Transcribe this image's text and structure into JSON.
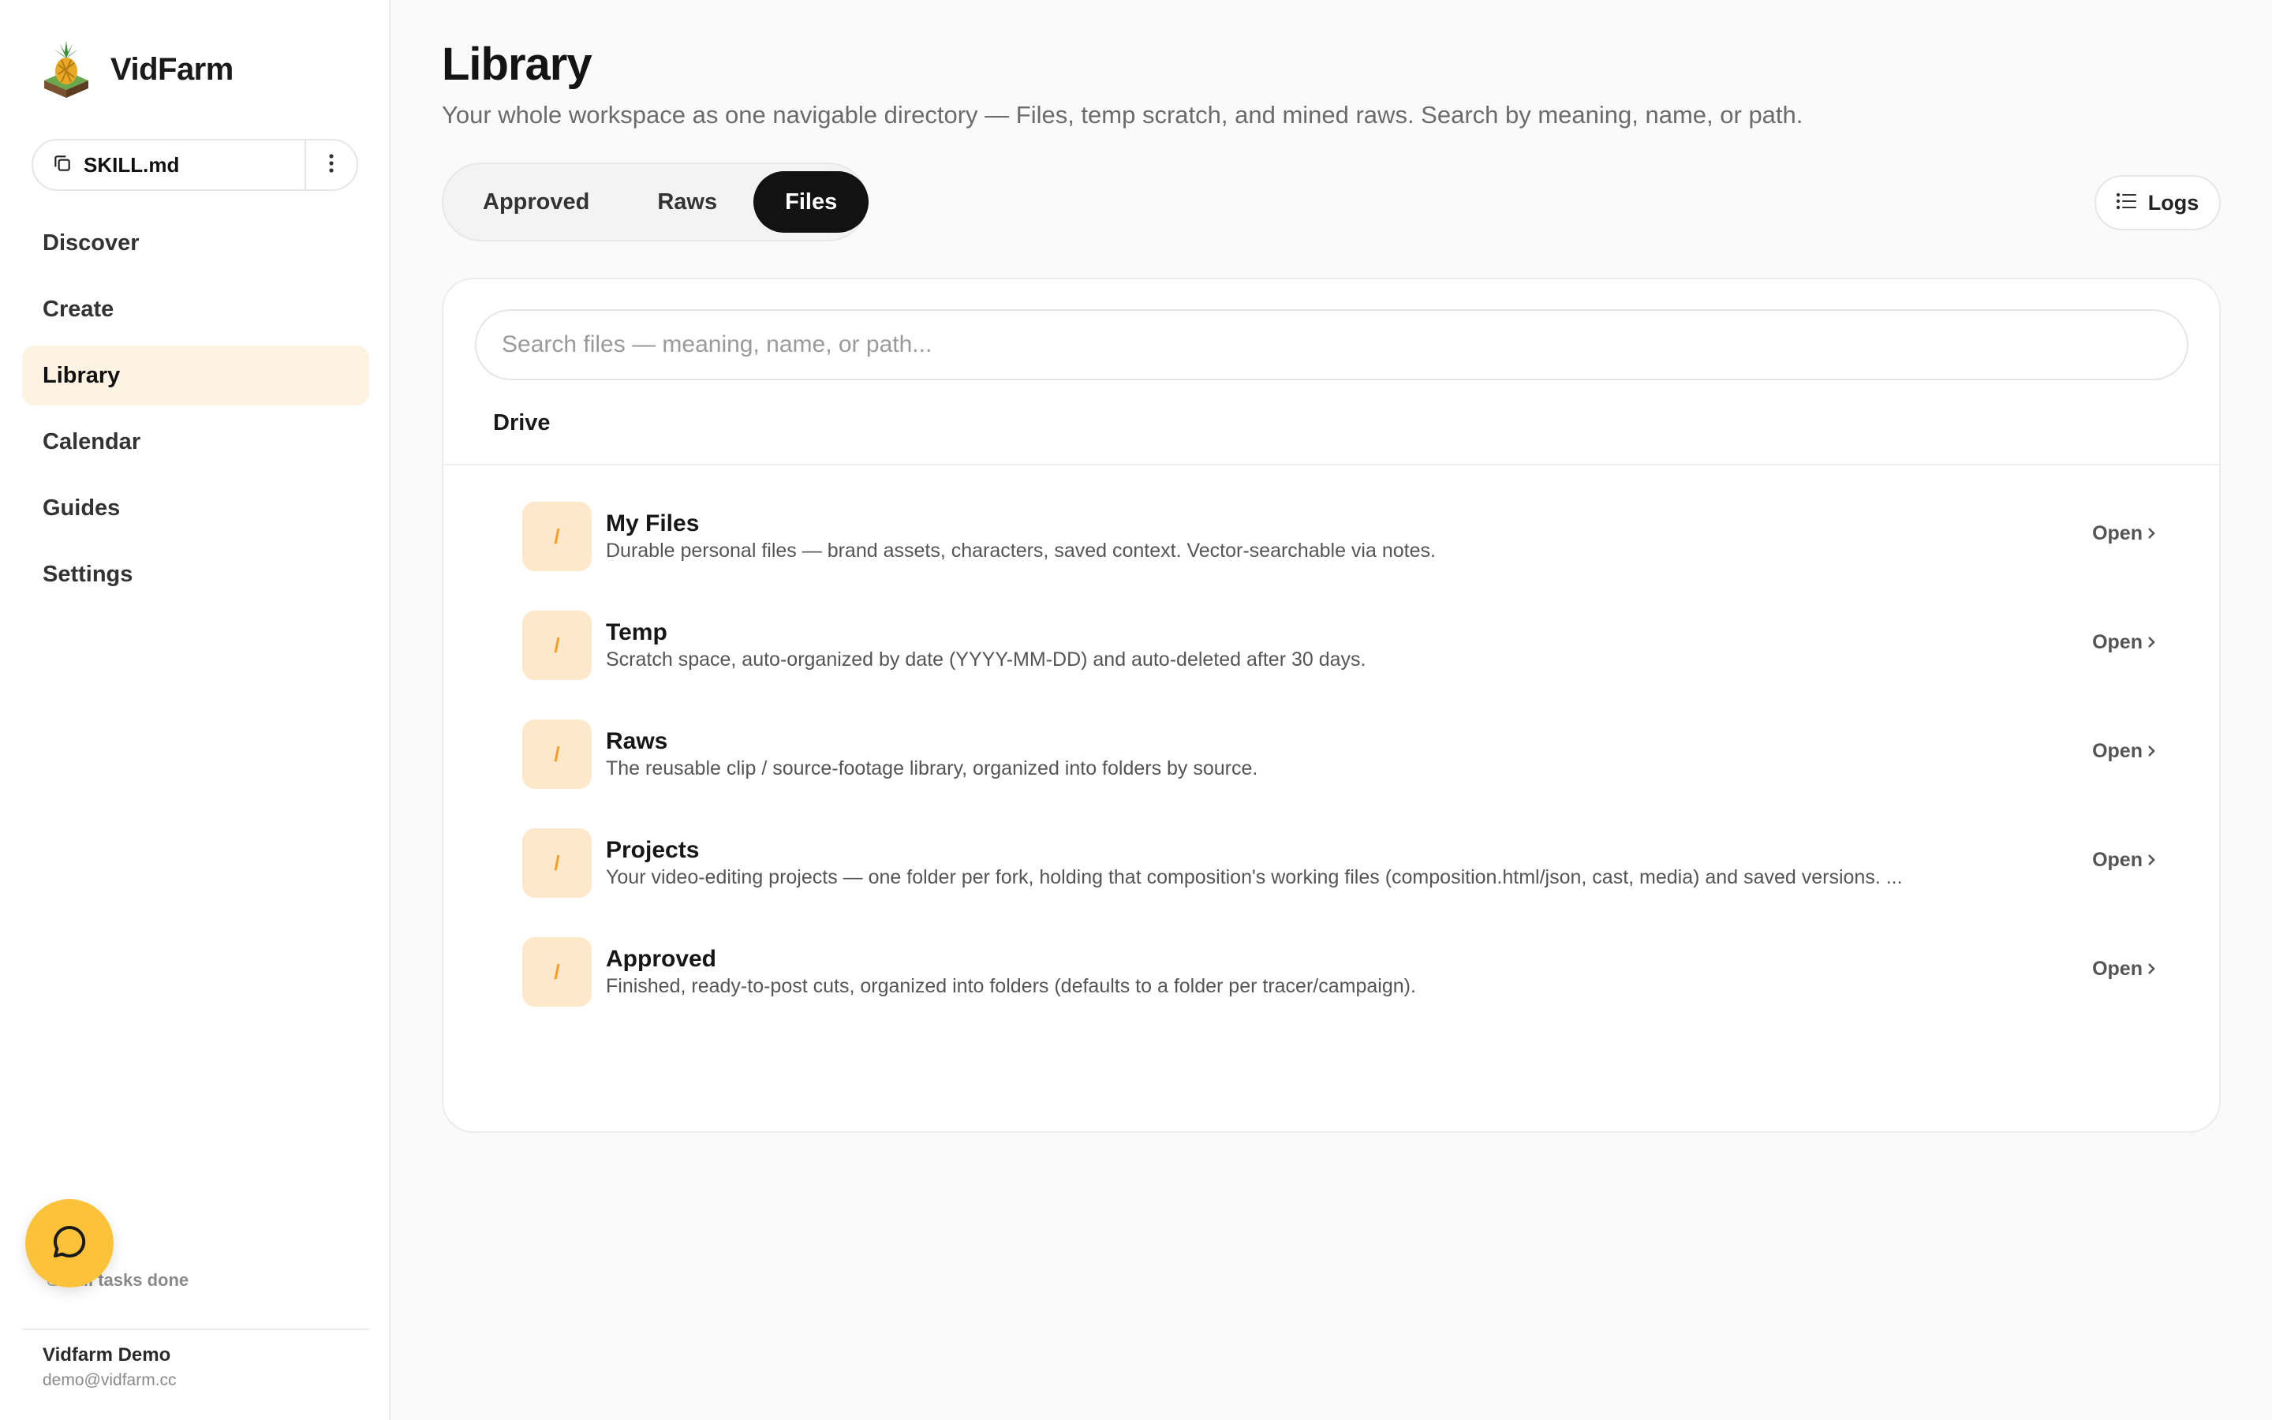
{
  "brand": {
    "name": "VidFarm"
  },
  "skill": {
    "label": "SKILL.md"
  },
  "nav": [
    {
      "label": "Discover",
      "active": false
    },
    {
      "label": "Create",
      "active": false
    },
    {
      "label": "Library",
      "active": true
    },
    {
      "label": "Calendar",
      "active": false
    },
    {
      "label": "Guides",
      "active": false
    },
    {
      "label": "Settings",
      "active": false
    }
  ],
  "tasks": {
    "label": "All tasks done"
  },
  "user": {
    "name": "Vidfarm Demo",
    "email": "demo@vidfarm.cc"
  },
  "page": {
    "title": "Library",
    "subtitle": "Your whole workspace as one navigable directory — Files, temp scratch, and mined raws. Search by meaning, name, or path."
  },
  "tabs": [
    {
      "label": "Approved",
      "active": false
    },
    {
      "label": "Raws",
      "active": false
    },
    {
      "label": "Files",
      "active": true
    }
  ],
  "logs": {
    "label": "Logs"
  },
  "search": {
    "placeholder": "Search files — meaning, name, or path..."
  },
  "drive": {
    "label": "Drive",
    "rows": [
      {
        "icon": "/",
        "title": "My Files",
        "desc": "Durable personal files — brand assets, characters, saved context. Vector-searchable via notes.",
        "open": "Open"
      },
      {
        "icon": "/",
        "title": "Temp",
        "desc": "Scratch space, auto-organized by date (YYYY-MM-DD) and auto-deleted after 30 days.",
        "open": "Open"
      },
      {
        "icon": "/",
        "title": "Raws",
        "desc": "The reusable clip / source-footage library, organized into folders by source.",
        "open": "Open"
      },
      {
        "icon": "/",
        "title": "Projects",
        "desc": "Your video-editing projects — one folder per fork, holding that composition's working files (composition.html/json, cast, media) and saved versions. ...",
        "open": "Open"
      },
      {
        "icon": "/",
        "title": "Approved",
        "desc": "Finished, ready-to-post cuts, organized into folders (defaults to a folder per tracer/campaign).",
        "open": "Open"
      }
    ]
  },
  "colors": {
    "accent": "#fbc23a",
    "active_nav_bg": "#fdf3e2",
    "folder_icon_bg": "#fde8cb",
    "active_tab_bg": "#121212"
  }
}
